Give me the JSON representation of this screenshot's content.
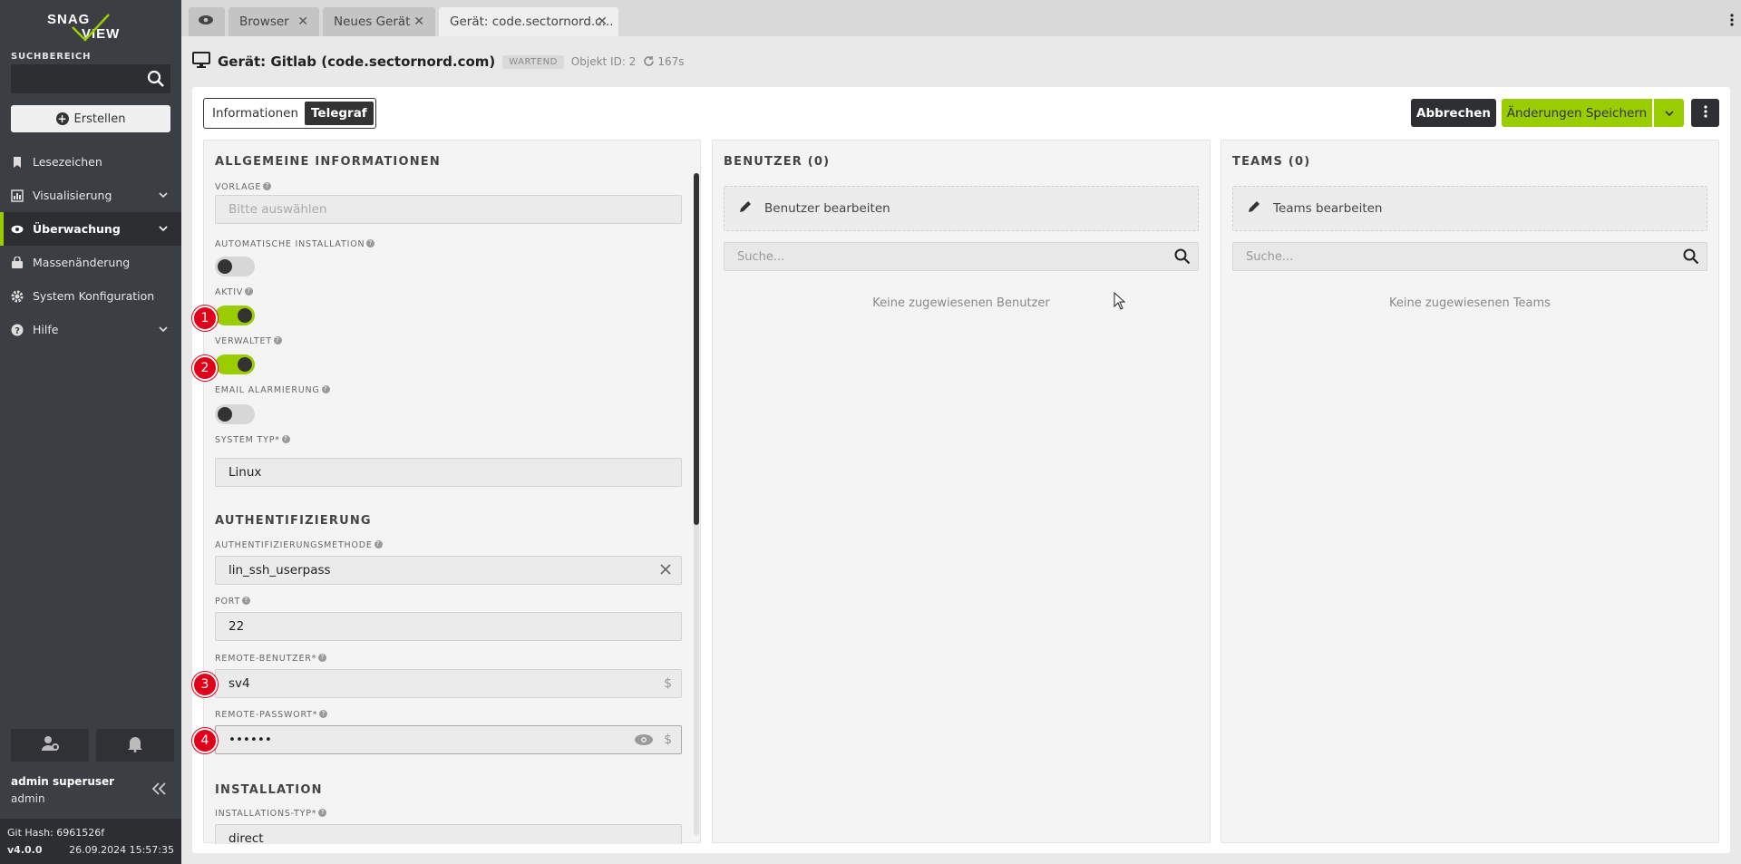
{
  "logo": {
    "line1": "SNAG",
    "line2": "VIEW"
  },
  "sidebar": {
    "search_label": "SUCHBEREICH",
    "create_label": "Erstellen",
    "items": [
      {
        "label": "Lesezeichen"
      },
      {
        "label": "Visualisierung"
      },
      {
        "label": "Überwachung"
      },
      {
        "label": "Massenänderung"
      },
      {
        "label": "System Konfiguration"
      },
      {
        "label": "Hilfe"
      }
    ],
    "user_name": "admin superuser",
    "user_role": "admin",
    "git_hash": "Git Hash: 6961526f",
    "version": "v4.0.0",
    "build_date": "26.09.2024 15:57:35"
  },
  "tabs": [
    {
      "label": "Browser"
    },
    {
      "label": "Neues Gerät"
    },
    {
      "label": "Gerät: code.sectornord.c..."
    }
  ],
  "header": {
    "title": "Gerät: Gitlab (code.sectornord.com)",
    "status": "WARTEND",
    "object_id": "Objekt ID: 2",
    "refresh": "167s"
  },
  "toolbar": {
    "seg_info": "Informationen",
    "seg_telegraf": "Telegraf",
    "cancel": "Abbrechen",
    "save": "Änderungen Speichern"
  },
  "form": {
    "sec_general": "ALLGEMEINE INFORMATIONEN",
    "vorlage_label": "VORLAGE",
    "vorlage_placeholder": "Bitte auswählen",
    "auto_install_label": "AUTOMATISCHE INSTALLATION",
    "aktiv_label": "AKTIV",
    "verwaltet_label": "VERWALTET",
    "email_label": "EMAIL ALARMIERUNG",
    "system_typ_label": "SYSTEM TYP",
    "system_typ_value": "Linux",
    "sec_auth": "AUTHENTIFIZIERUNG",
    "auth_method_label": "AUTHENTIFIZIERUNGSMETHODE",
    "auth_method_value": "lin_ssh_userpass",
    "port_label": "PORT",
    "port_value": "22",
    "remote_user_label": "REMOTE-BENUTZER",
    "remote_user_value": "sv4",
    "remote_pw_label": "REMOTE-PASSWORT",
    "remote_pw_value": "••••••",
    "sec_install": "INSTALLATION",
    "install_type_label": "INSTALLATIONS-TYP",
    "install_type_value": "direct",
    "toggles": {
      "auto_install": false,
      "aktiv": true,
      "verwaltet": true,
      "email": false
    }
  },
  "users": {
    "title": "BENUTZER (0)",
    "edit": "Benutzer bearbeiten",
    "search_placeholder": "Suche...",
    "empty": "Keine zugewiesenen Benutzer"
  },
  "teams": {
    "title": "TEAMS (0)",
    "edit": "Teams bearbeiten",
    "search_placeholder": "Suche...",
    "empty": "Keine zugewiesenen Teams"
  },
  "markers": [
    "1",
    "2",
    "3",
    "4"
  ],
  "colors": {
    "accent": "#9acd00",
    "sidebar": "#3b3e42",
    "marker": "#e0001a"
  }
}
